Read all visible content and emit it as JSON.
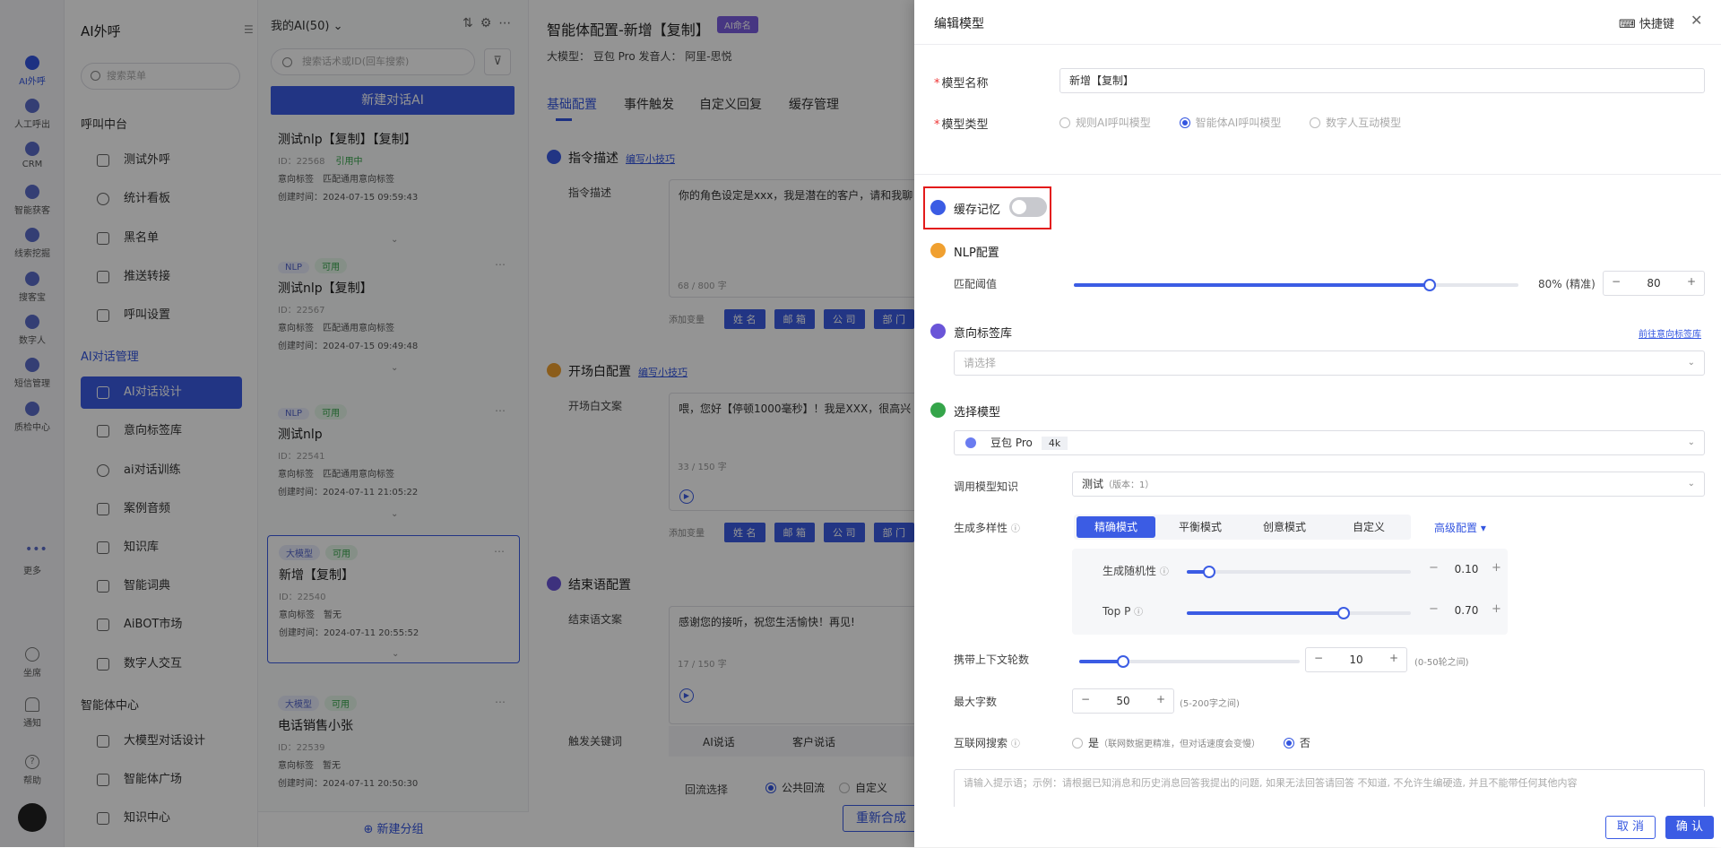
{
  "rail": {
    "items": [
      {
        "label": "AI外呼"
      },
      {
        "label": "人工呼出"
      },
      {
        "label": "CRM"
      },
      {
        "label": "智能获客"
      },
      {
        "label": "线索挖掘"
      },
      {
        "label": "搜客宝"
      },
      {
        "label": "数字人"
      },
      {
        "label": "短信管理"
      },
      {
        "label": "质检中心"
      },
      {
        "label": "更多"
      },
      {
        "label": "坐席"
      },
      {
        "label": "通知"
      },
      {
        "label": "帮助"
      }
    ]
  },
  "sidebar": {
    "title": "AI外呼",
    "search_placeholder": "搜索菜单",
    "group1": "呼叫中台",
    "items1": [
      {
        "label": "测试外呼"
      },
      {
        "label": "统计看板"
      },
      {
        "label": "黑名单"
      },
      {
        "label": "推送转接"
      },
      {
        "label": "呼叫设置"
      }
    ],
    "group2": "AI对话管理",
    "items2": [
      {
        "label": "AI对话设计"
      },
      {
        "label": "意向标签库"
      },
      {
        "label": "ai对话训练"
      },
      {
        "label": "案例音频"
      },
      {
        "label": "知识库"
      },
      {
        "label": "智能词典"
      },
      {
        "label": "AiBOT市场"
      },
      {
        "label": "数字人交互"
      }
    ],
    "group3": "智能体中心",
    "items3": [
      {
        "label": "大模型对话设计"
      },
      {
        "label": "智能体广场"
      },
      {
        "label": "知识中心"
      }
    ]
  },
  "list": {
    "header": "我的AI(50)",
    "search_placeholder": "搜索话术或ID(回车搜索)",
    "new_button": "新建对话AI",
    "footer": "新建分组",
    "cards": [
      {
        "tag1": "",
        "tag2": "",
        "name": "测试nlp【复制】【复制】",
        "id": "ID：22568",
        "status": "引用中",
        "intent": "意向标签　匹配通用意向标签",
        "created": "创建时间：2024-07-15 09:59:43"
      },
      {
        "tag1": "NLP",
        "tag2": "可用",
        "name": "测试nlp【复制】",
        "id": "ID：22567",
        "status": "",
        "intent": "意向标签　匹配通用意向标签",
        "created": "创建时间：2024-07-15 09:49:48"
      },
      {
        "tag1": "NLP",
        "tag2": "可用",
        "name": "测试nlp",
        "id": "ID：22541",
        "status": "",
        "intent": "意向标签　匹配通用意向标签",
        "created": "创建时间：2024-07-11 21:05:22"
      },
      {
        "tag1": "大模型",
        "tag2": "可用",
        "name": "新增【复制】",
        "id": "ID：22540",
        "status": "",
        "intent": "意向标签　暂无",
        "created": "创建时间：2024-07-11 20:55:52"
      },
      {
        "tag1": "大模型",
        "tag2": "可用",
        "name": "电话销售小张",
        "id": "ID：22539",
        "status": "",
        "intent": "意向标签　暂无",
        "created": "创建时间：2024-07-11 20:50:30"
      }
    ]
  },
  "main": {
    "title": "智能体配置-新增【复制】",
    "badge": "AI命名",
    "model_line": "大模型：  豆包 Pro   发音人：      阿里-思悦",
    "tabs": [
      {
        "label": "基础配置"
      },
      {
        "label": "事件触发"
      },
      {
        "label": "自定义回复"
      },
      {
        "label": "缓存管理"
      }
    ],
    "sec1": "指令描述",
    "sec1_link": "编写小技巧",
    "sec1_label": "指令描述",
    "sec1_text": "你的角色设定是xxx，我是潜在的客户，请和我聊",
    "sec1_count": "68 / 800 字",
    "add_var": "添加变量",
    "chips": [
      {
        "label": "姓 名"
      },
      {
        "label": "邮 箱"
      },
      {
        "label": "公 司"
      },
      {
        "label": "部 门"
      }
    ],
    "sec2": "开场白配置",
    "sec2_link": "编写小技巧",
    "sec2_label": "开场白文案",
    "sec2_text": "喂，您好【停顿1000毫秒】！我是XXX，很高兴",
    "sec2_count": "33 / 150 字",
    "sec3": "结束语配置",
    "sec3_label": "结束语文案",
    "sec3_text": "感谢您的接听，祝您生活愉快！再见!",
    "sec3_count": "17 / 150 字",
    "trigger_label": "触发关键词",
    "trigger_tab1": "AI说话",
    "trigger_tab2": "客户说话",
    "reply_label": "回流选择",
    "reply_opt1": "公共回流",
    "reply_opt2": "自定义",
    "regen": "重新合成"
  },
  "drawer": {
    "title": "编辑模型",
    "hotkey": "快捷键",
    "name_label": "模型名称",
    "name_value": "新增【复制】",
    "type_label": "模型类型",
    "type_opts": [
      {
        "label": "规则AI呼叫模型"
      },
      {
        "label": "智能体AI呼叫模型"
      },
      {
        "label": "数字人互动模型"
      }
    ],
    "cache_label": "缓存记忆",
    "cache_on": false,
    "nlp_label": "NLP配置",
    "match_label": "匹配阈值",
    "match_text": "80% (精准)",
    "match_value": "80",
    "match_fraction": 0.8,
    "intent_label": "意向标签库",
    "intent_link": "前往意向标签库",
    "intent_placeholder": "请选择",
    "model_label": "选择模型",
    "model_value": "豆包 Pro",
    "model_tag": "4k",
    "knowledge_label": "调用模型知识",
    "knowledge_value": "测试",
    "knowledge_ver": "（版本：1）",
    "diversity_label": "生成多样性",
    "diversity_opts": [
      {
        "label": "精确模式"
      },
      {
        "label": "平衡模式"
      },
      {
        "label": "创意模式"
      },
      {
        "label": "自定义"
      }
    ],
    "advanced": "高级配置",
    "rand_label": "生成随机性",
    "rand_value": "0.10",
    "rand_fraction": 0.1,
    "topp_label": "Top P",
    "topp_value": "0.70",
    "topp_fraction": 0.7,
    "ctx_label": "携带上下文轮数",
    "ctx_value": "10",
    "ctx_hint": "(0-50轮之间)",
    "ctx_fraction": 0.2,
    "max_label": "最大字数",
    "max_value": "50",
    "max_hint": "(5-200字之间)",
    "web_label": "互联网搜索",
    "web_yes": "是",
    "web_yes_hint": "（联网数据更精准，但对话速度会变慢）",
    "web_no": "否",
    "prompt_placeholder": "请输入提示语；示例：请根据已知消息和历史消息回答我提出的问题, 如果无法回答请回答 不知道, 不允许生编硬造, 并且不能带任何其他内容",
    "cancel": "取 消",
    "confirm": "确 认"
  },
  "colors": {
    "accent": "#3b5ce4",
    "highlight": "#e31b1b",
    "success": "#35a54a"
  }
}
